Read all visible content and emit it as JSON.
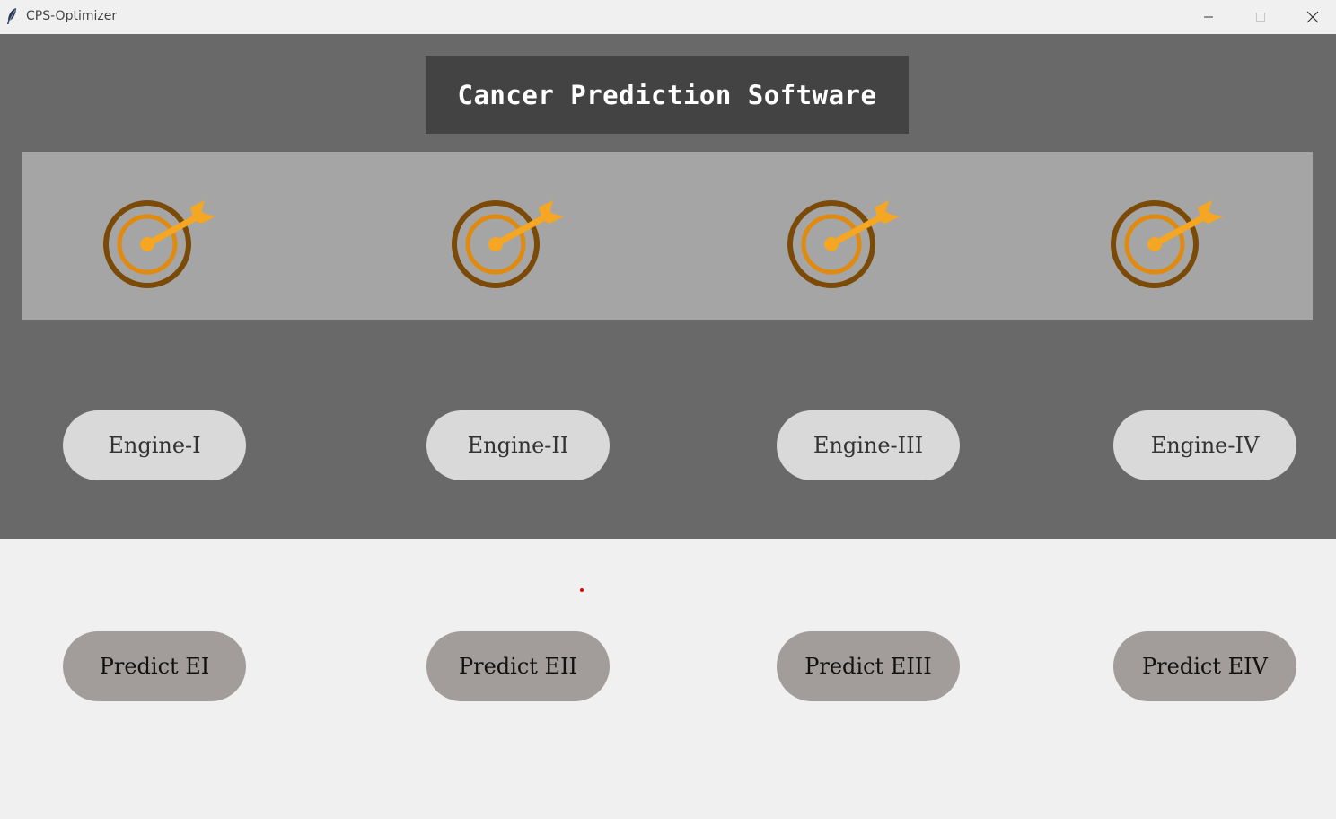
{
  "window": {
    "title": "CPS-Optimizer",
    "controls": [
      "minimize",
      "maximize",
      "close"
    ]
  },
  "header": {
    "title": "Cancer Prediction Software"
  },
  "icons": [
    {
      "name": "target-arrow-icon"
    },
    {
      "name": "target-arrow-icon"
    },
    {
      "name": "target-arrow-icon"
    },
    {
      "name": "target-arrow-icon"
    }
  ],
  "engines": [
    {
      "label": "Engine-I"
    },
    {
      "label": "Engine-II"
    },
    {
      "label": "Engine-III"
    },
    {
      "label": "Engine-IV"
    }
  ],
  "predict": [
    {
      "label": "Predict EI"
    },
    {
      "label": "Predict EII"
    },
    {
      "label": "Predict EIII"
    },
    {
      "label": "Predict EIV"
    }
  ],
  "colors": {
    "header_bg": "#696969",
    "title_box_bg": "#434343",
    "icon_strip_bg": "#a5a5a5",
    "engine_button_bg": "#d9d9d9",
    "predict_button_bg": "#a29d9b",
    "page_bg": "#f0f0f0",
    "target_outer": "#7a4a06",
    "target_inner": "#e08a10",
    "arrow": "#f5a623"
  }
}
